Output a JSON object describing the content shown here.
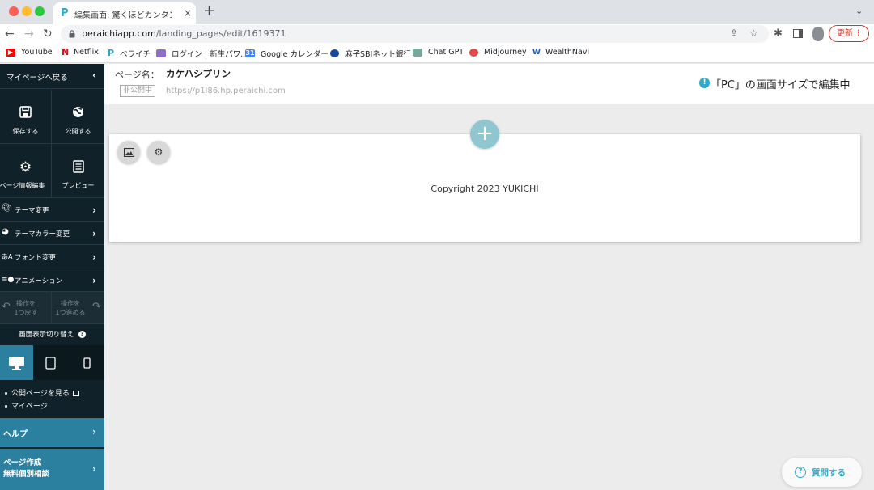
{
  "browser": {
    "tab_title": "編集画面: 驚くほどカンタン！無料",
    "tab_close": "×",
    "new_tab": "+",
    "tab_menu": "⌄",
    "url_host": "peraichiapp.com",
    "url_path": "/landing_pages/edit/1619371",
    "update_label": "更新",
    "update_dots": "⋮",
    "bookmarks": [
      "YouTube",
      "Netflix",
      "ペライチ",
      "ログイン | 新生パワ...",
      "Google カレンダー",
      "麻子SBIネット銀行",
      "Chat GPT",
      "Midjourney",
      "WealthNavi"
    ]
  },
  "sidebar": {
    "back_label": "マイページへ戻る",
    "save_label": "保存する",
    "publish_label": "公開する",
    "page_info_label": "ページ情報編集",
    "preview_label": "プレビュー",
    "menu": [
      "テーマ変更",
      "テーマカラー変更",
      "フォント変更",
      "アニメーション"
    ],
    "undo_label": "操作を\n1つ戻す",
    "redo_label": "操作を\n1つ進める",
    "display_switch": "画面表示切り替え",
    "links": [
      "公開ページを見る",
      "マイページ"
    ],
    "help_label": "ヘルプ",
    "consult_label": "ページ作成\n無料個別相談"
  },
  "header": {
    "page_name_label": "ページ名：",
    "page_name": "カケハシプリン",
    "status": "非公開中",
    "page_url": "https://p1l86.hp.peraichi.com",
    "size_note": "「PC」の画面サイズで編集中"
  },
  "canvas": {
    "copyright": "Copyright 2023 YUKICHI"
  },
  "ask_label": "質問する",
  "colors": {
    "sidebar_bg": "#102129",
    "accent": "#2b7f9f",
    "info": "#36a7c7"
  }
}
